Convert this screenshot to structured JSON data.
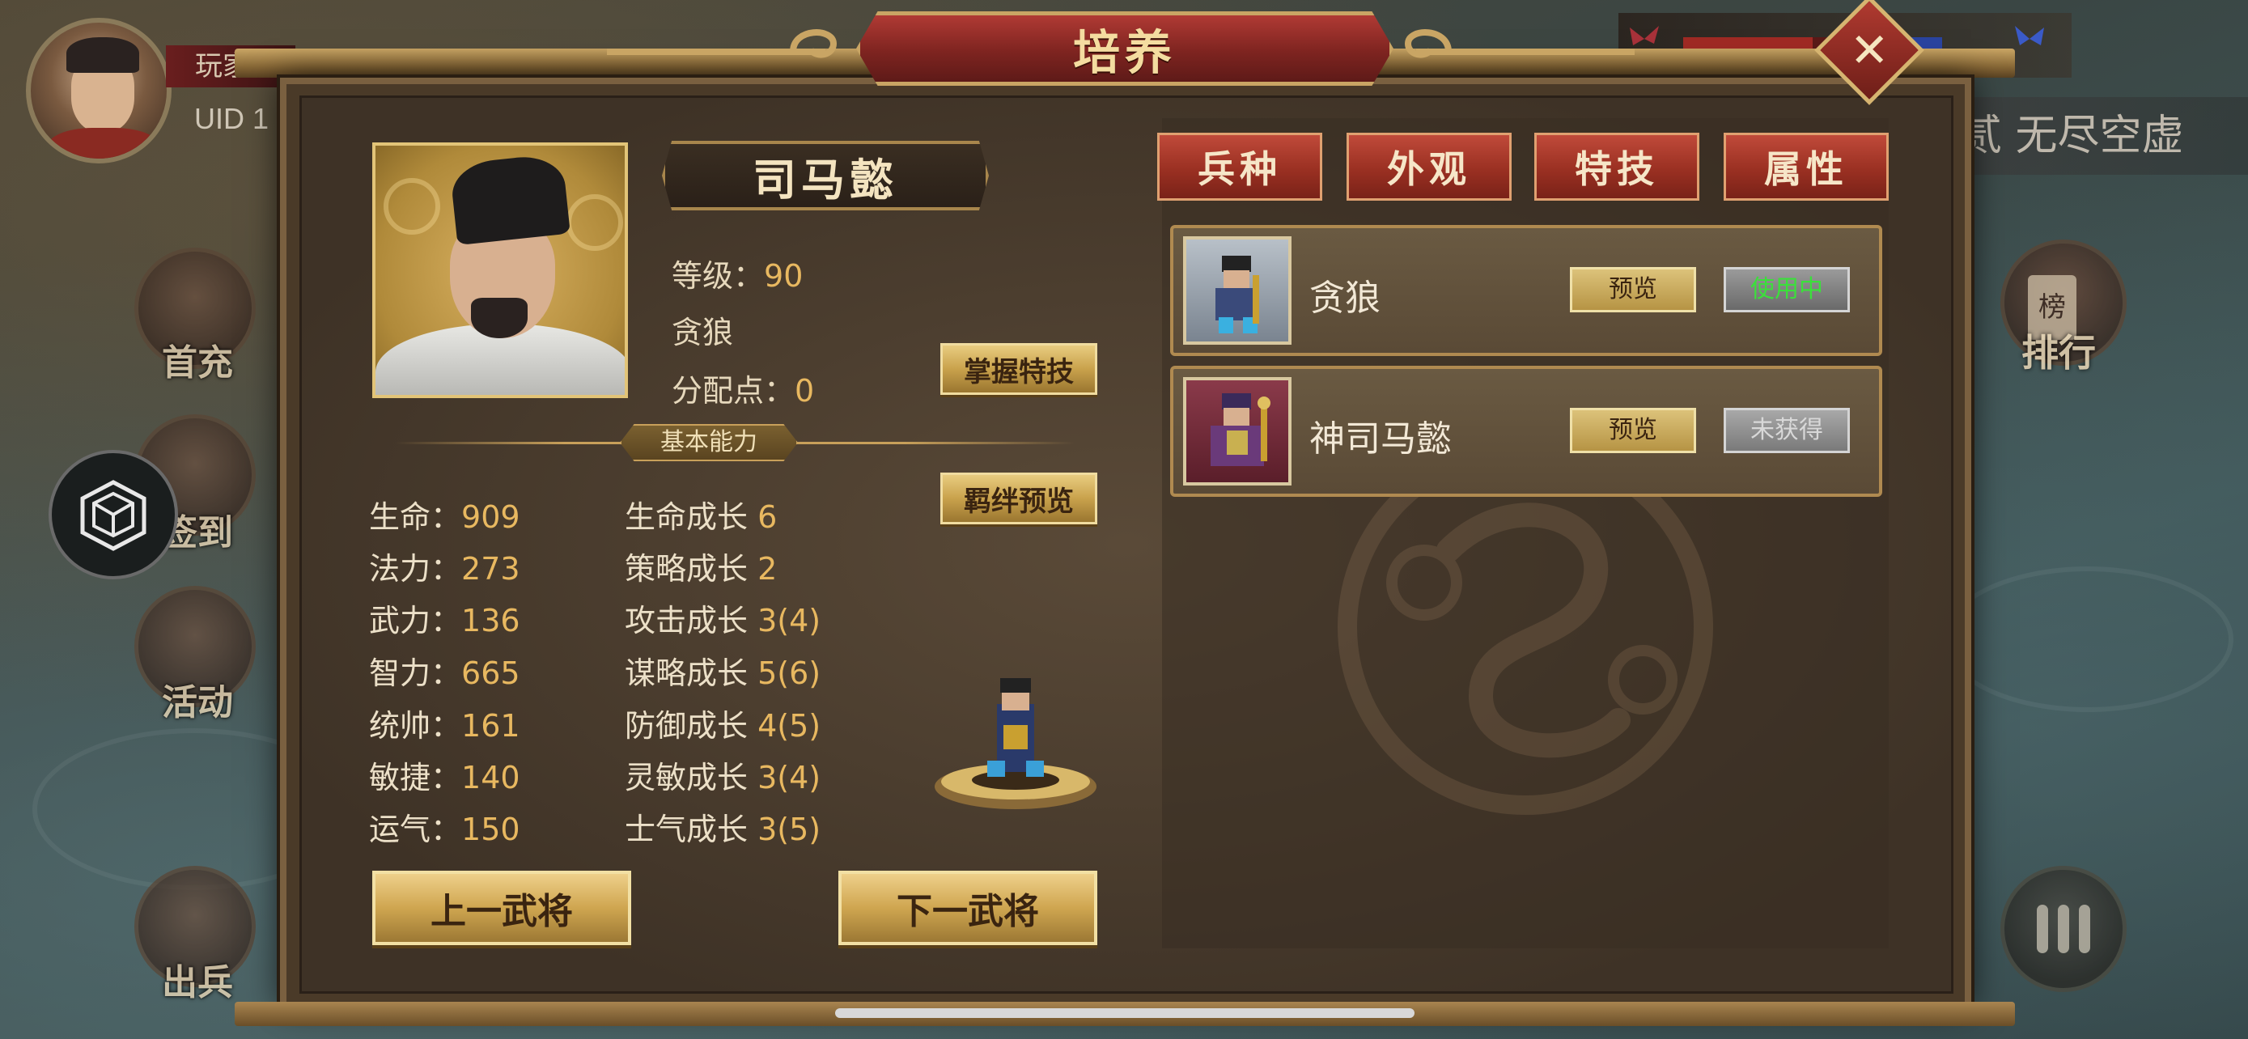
{
  "player": {
    "name_prefix": "玩家",
    "uid_label": "UID  1"
  },
  "side_buttons": {
    "first_recharge": "首充",
    "sign_in": "签到",
    "activity": "活动",
    "dispatch": "出兵"
  },
  "right_side": {
    "banner": "贰 无尽空虚",
    "rank_badge": "榜",
    "rank_label": "排行"
  },
  "dialog": {
    "title": "培养",
    "close_symbol": "✕"
  },
  "hero": {
    "name": "司马懿",
    "level_label": "等级：",
    "level_value": "90",
    "troop_line": "贪狼",
    "points_label": "分配点：",
    "points_value": "0",
    "master_skill_btn": "掌握特技",
    "bond_preview_btn": "羁绊预览"
  },
  "basic": {
    "section_title": "基本能力",
    "stats": [
      {
        "label": "生命：",
        "value": "909"
      },
      {
        "label": "法力：",
        "value": "273"
      },
      {
        "label": "武力：",
        "value": "136"
      },
      {
        "label": "智力：",
        "value": "665"
      },
      {
        "label": "统帅：",
        "value": "161"
      },
      {
        "label": "敏捷：",
        "value": "140"
      },
      {
        "label": "运气：",
        "value": "150"
      }
    ],
    "growth": [
      {
        "label": "生命成长 ",
        "value": "6"
      },
      {
        "label": "策略成长 ",
        "value": "2"
      },
      {
        "label": "攻击成长 ",
        "value": "3(4)"
      },
      {
        "label": "谋略成长 ",
        "value": "5(6)"
      },
      {
        "label": "防御成长 ",
        "value": "4(5)"
      },
      {
        "label": "灵敏成长 ",
        "value": "3(4)"
      },
      {
        "label": "士气成长 ",
        "value": "3(5)"
      }
    ]
  },
  "nav": {
    "prev": "上一武将",
    "next": "下一武将"
  },
  "tabs": [
    "兵种",
    "外观",
    "特技",
    "属性"
  ],
  "troops": [
    {
      "name": "贪狼",
      "preview": "预览",
      "status": "使用中",
      "status_color": "#3be03b"
    },
    {
      "name": "神司马懿",
      "preview": "预览",
      "status": "未获得",
      "status_color": "#d8d8d8"
    }
  ],
  "colors": {
    "accent_gold": "#e8b860",
    "tab_red": "#9a3022",
    "title_red": "#7e2420"
  }
}
